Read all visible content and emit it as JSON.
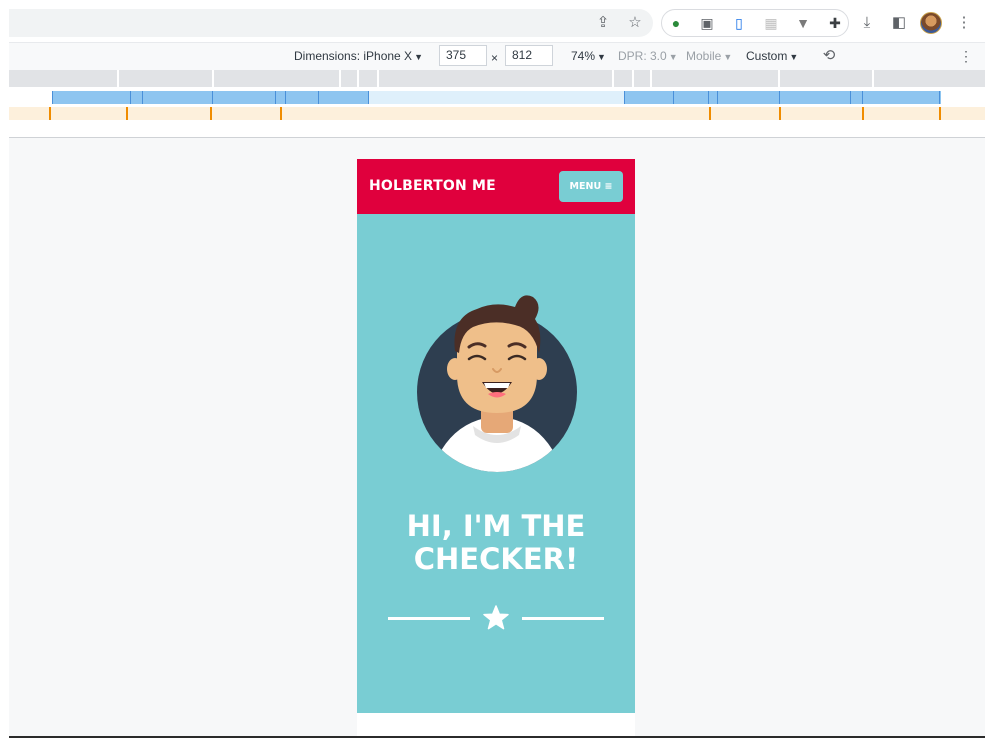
{
  "browser": {
    "toolbar_icons": [
      "share-icon",
      "bookmark-star-icon"
    ],
    "extension_icons": [
      "globe-extension-icon",
      "puzzle-extension-icon",
      "device-extension-icon",
      "grid-extension-icon",
      "vue-extension-icon",
      "extensions-icon"
    ],
    "right_icons": [
      "download-icon",
      "side-panel-icon",
      "profile-avatar",
      "menu-kebab-icon"
    ]
  },
  "device_toolbar": {
    "dimensions_label": "Dimensions: iPhone X",
    "width": "375",
    "times": "×",
    "height": "812",
    "zoom": "74%",
    "dpr": "DPR: 3.0",
    "mode": "Mobile",
    "throttle": "Custom"
  },
  "site": {
    "brand": "HOLBERTON ME",
    "menu_label": "MENU ≡",
    "hero_title_line1": "HI, I'M THE",
    "hero_title_line2": "CHECKER!"
  },
  "colors": {
    "header_red": "#e0003d",
    "teal": "#79cdd3",
    "avatar_bg": "#2e3e50",
    "skin": "#efbf8a",
    "hair": "#4b2e26"
  }
}
